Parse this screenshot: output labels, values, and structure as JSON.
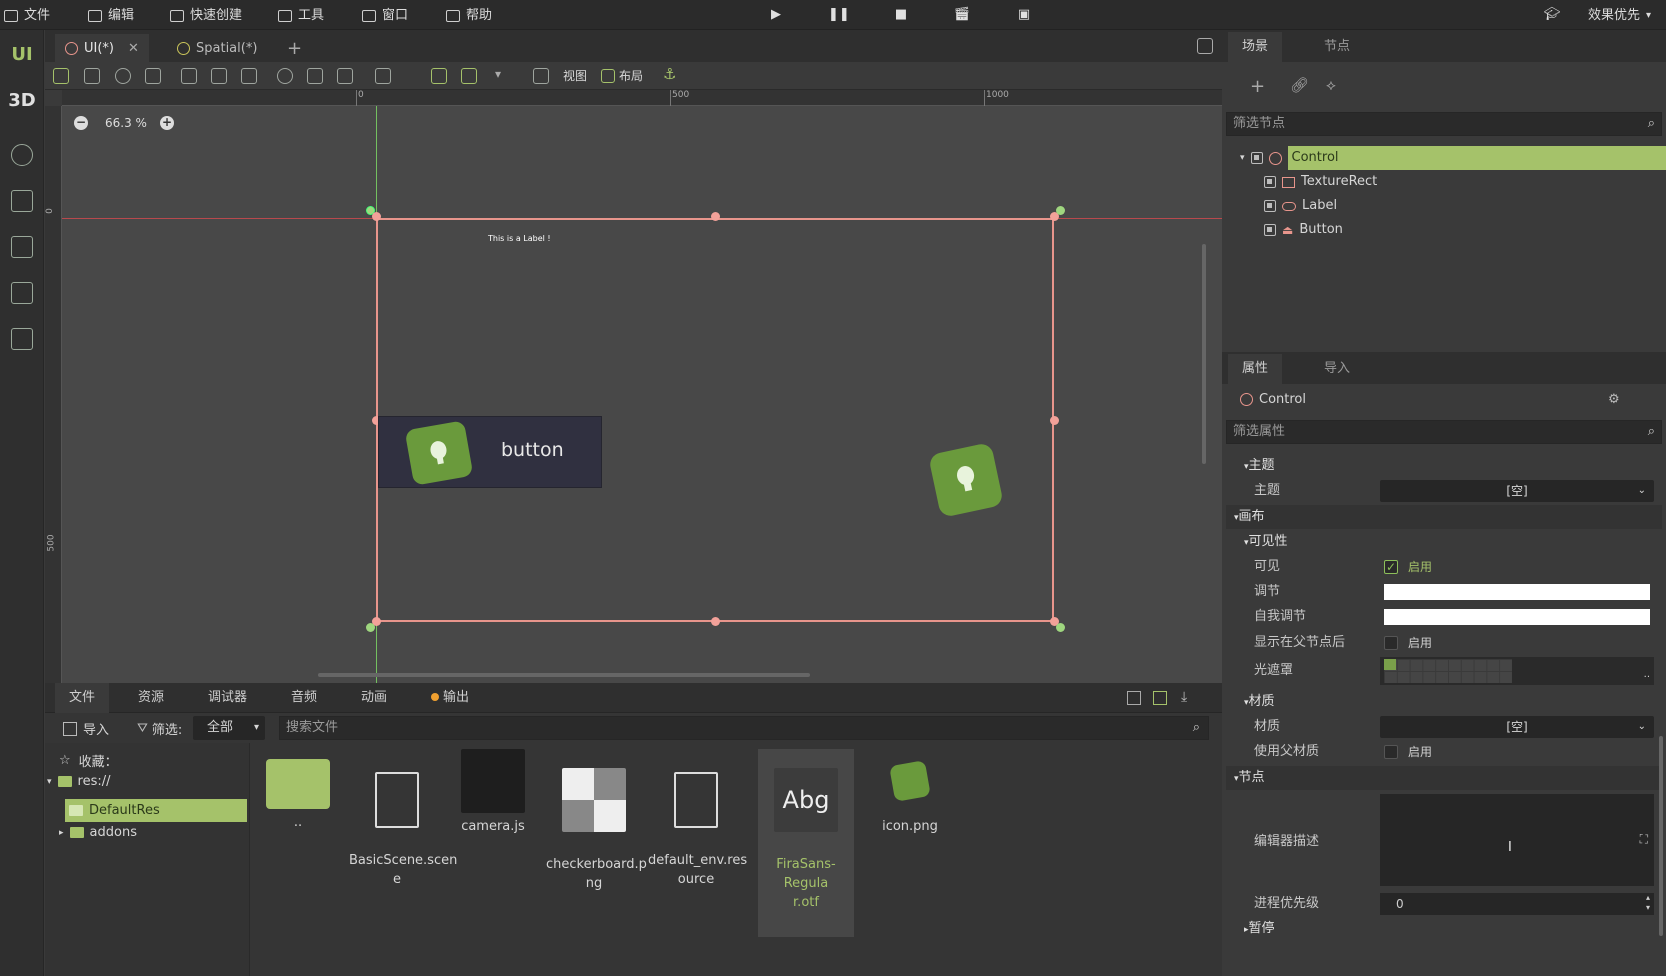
{
  "menu": {
    "items": [
      "文件",
      "编辑",
      "快速创建",
      "工具",
      "窗口",
      "帮助"
    ],
    "right_label": "效果优先"
  },
  "rail": {
    "ui": "UI",
    "three_d": "3D"
  },
  "scene_tabs": {
    "tab1": "UI(*)",
    "tab2": "Spatial(*)",
    "add": "+"
  },
  "toolbar": {
    "view": "视图",
    "layout": "布局"
  },
  "viewport": {
    "zoom": "66.3 %",
    "label_text": "This is a Label !",
    "button_text": "button",
    "ruler_top": [
      "0",
      "500",
      "1000"
    ],
    "ruler_left": [
      "0",
      "500"
    ]
  },
  "right_tabs": {
    "scene": "场景",
    "node": "节点",
    "inspector": "属性",
    "import": "导入"
  },
  "scene_panel": {
    "filter_placeholder": "筛选节点",
    "tree": [
      {
        "name": "Control"
      },
      {
        "name": "TextureRect"
      },
      {
        "name": "Label"
      },
      {
        "name": "Button"
      }
    ]
  },
  "inspector": {
    "node_name": "Control",
    "filter_placeholder": "筛选属性",
    "theme_section": "主题",
    "theme_label": "主题",
    "theme_value": "[空]",
    "canvas_section": "画布",
    "visibility_section": "可见性",
    "visible_label": "可见",
    "visible_value": "启用",
    "modulate_label": "调节",
    "self_modulate_label": "自我调节",
    "show_behind_label": "显示在父节点后",
    "show_behind_value": "启用",
    "light_mask_label": "光遮罩",
    "material_section": "材质",
    "material_label": "材质",
    "material_value": "[空]",
    "use_parent_label": "使用父材质",
    "use_parent_value": "启用",
    "node_section": "节点",
    "editor_desc_label": "编辑器描述",
    "process_priority_label": "进程优先级",
    "process_priority_value": "0",
    "pause_section": "暂停"
  },
  "bottom": {
    "tabs": [
      "文件",
      "资源",
      "调试器",
      "音频",
      "动画",
      "输出"
    ],
    "import": "导入",
    "filter": "筛选:",
    "filter_value": "全部",
    "search_placeholder": "搜索文件",
    "favorites": "收藏：",
    "res_root": "res://",
    "folders": [
      "DefaultRes",
      "addons"
    ],
    "files": [
      {
        "name": ".."
      },
      {
        "name": "BasicScene.scen\ne"
      },
      {
        "name": "camera.js"
      },
      {
        "name": "checkerboard.p\nng"
      },
      {
        "name": "default_env.res\nource"
      },
      {
        "name": "FiraSans-Regula\nr.otf"
      },
      {
        "name": "icon.png"
      }
    ],
    "font_preview": "Abg"
  },
  "colors": {
    "accent": "#a5c26a",
    "selection_outline": "#e8958c",
    "guide_green": "#74c060"
  }
}
